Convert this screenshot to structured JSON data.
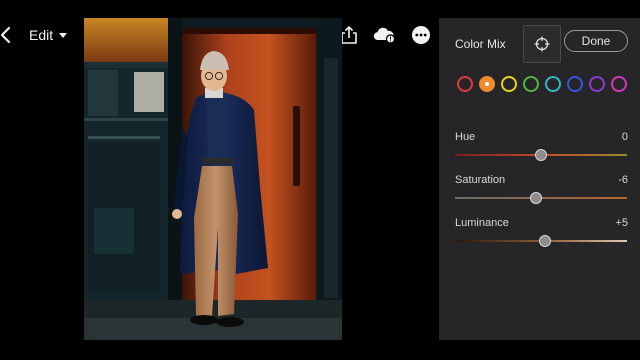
{
  "toolbar": {
    "edit_label": "Edit",
    "icons": [
      "chevron-left-icon",
      "caret-down-icon",
      "undo-icon",
      "help-icon",
      "share-icon",
      "cloud-sync-icon",
      "more-icon"
    ]
  },
  "panel": {
    "title": "Color Mix",
    "target_icon": "target-adjust-icon",
    "done_label": "Done",
    "swatches": [
      {
        "name": "red",
        "color": "#e23b3b",
        "selected": false
      },
      {
        "name": "orange",
        "color": "#f08a2c",
        "selected": true
      },
      {
        "name": "yellow",
        "color": "#e9d21f",
        "selected": false
      },
      {
        "name": "green",
        "color": "#53b548",
        "selected": false
      },
      {
        "name": "aqua",
        "color": "#2fb8c8",
        "selected": false
      },
      {
        "name": "blue",
        "color": "#3b55d9",
        "selected": false
      },
      {
        "name": "purple",
        "color": "#8d3ad1",
        "selected": false
      },
      {
        "name": "magenta",
        "color": "#c93ab8",
        "selected": false
      }
    ],
    "sliders": [
      {
        "label": "Hue",
        "value": "0",
        "fraction": 0.5
      },
      {
        "label": "Saturation",
        "value": "-6",
        "fraction": 0.47
      },
      {
        "label": "Luminance",
        "value": "+5",
        "fraction": 0.525
      }
    ]
  }
}
